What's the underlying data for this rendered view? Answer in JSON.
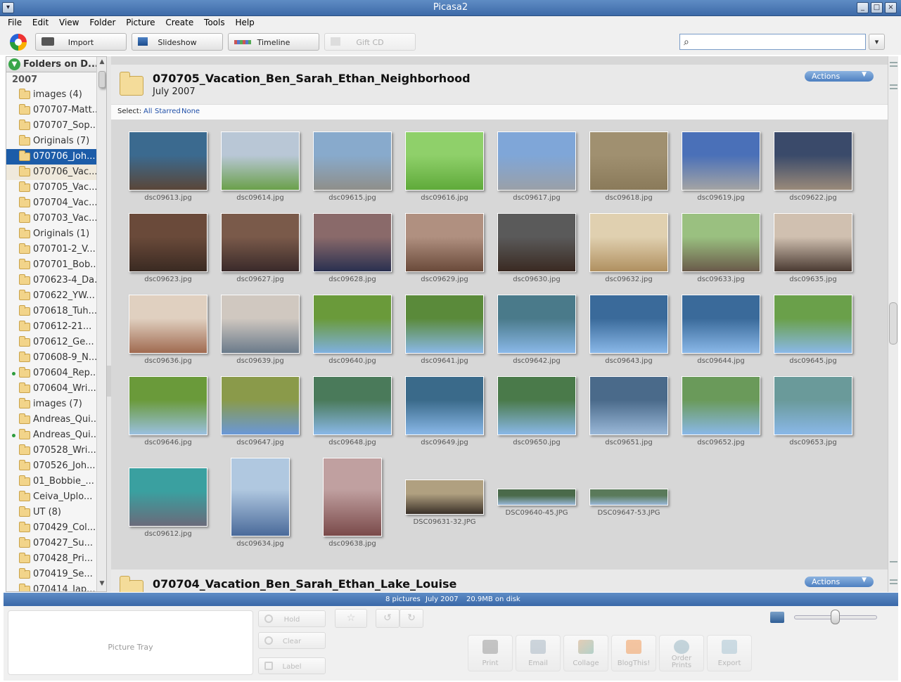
{
  "window": {
    "title": "Picasa2"
  },
  "menu": [
    "File",
    "Edit",
    "View",
    "Folder",
    "Picture",
    "Create",
    "Tools",
    "Help"
  ],
  "toolbar": {
    "import": "Import",
    "slideshow": "Slideshow",
    "timeline": "Timeline",
    "giftcd": "Gift CD"
  },
  "sidebar": {
    "header": "Folders on D...",
    "year": "2007",
    "folders": [
      {
        "label": "images (4)"
      },
      {
        "label": "070707-Matt..."
      },
      {
        "label": "070707_Sop..."
      },
      {
        "label": "Originals (7)"
      },
      {
        "label": "070706_Joh..."
      },
      {
        "label": "070706_Vac..."
      },
      {
        "label": "070705_Vac..."
      },
      {
        "label": "070704_Vac..."
      },
      {
        "label": "070703_Vac..."
      },
      {
        "label": "Originals (1)"
      },
      {
        "label": "070701-2_V..."
      },
      {
        "label": "070701_Bob..."
      },
      {
        "label": "070623-4_Da..."
      },
      {
        "label": "070622_YW..."
      },
      {
        "label": "070618_Tuh..."
      },
      {
        "label": "070612-21..."
      },
      {
        "label": "070612_Ge..."
      },
      {
        "label": "070608-9_N..."
      },
      {
        "label": "070604_Rep..."
      },
      {
        "label": "070604_Wri..."
      },
      {
        "label": "images (7)"
      },
      {
        "label": "Andreas_Qui..."
      },
      {
        "label": "Andreas_Qui..."
      },
      {
        "label": "070528_Wri..."
      },
      {
        "label": "070526_Joh..."
      },
      {
        "label": "01_Bobbie_..."
      },
      {
        "label": "Ceiva_Uplo..."
      },
      {
        "label": "UT (8)"
      },
      {
        "label": "070429_Col..."
      },
      {
        "label": "070427_Su..."
      },
      {
        "label": "070428_Pri..."
      },
      {
        "label": "070419_Se..."
      },
      {
        "label": "070414_Jap..."
      }
    ]
  },
  "album1": {
    "title": "070705_Vacation_Ben_Sarah_Ethan_Neighborhood",
    "date": "July 2007",
    "actions": "Actions"
  },
  "album2": {
    "title": "070704_Vacation_Ben_Sarah_Ethan_Lake_Louise",
    "actions": "Actions"
  },
  "select": {
    "label": "Select:",
    "all": "All",
    "starred": "Starred",
    "none": "None"
  },
  "photos": [
    "dsc09613.jpg",
    "dsc09614.jpg",
    "dsc09615.jpg",
    "dsc09616.jpg",
    "dsc09617.jpg",
    "dsc09618.jpg",
    "dsc09619.jpg",
    "dsc09622.jpg",
    "dsc09623.jpg",
    "dsc09627.jpg",
    "dsc09628.jpg",
    "dsc09629.jpg",
    "dsc09630.jpg",
    "dsc09632.jpg",
    "dsc09633.jpg",
    "dsc09635.jpg",
    "dsc09636.jpg",
    "dsc09639.jpg",
    "dsc09640.jpg",
    "dsc09641.jpg",
    "dsc09642.jpg",
    "dsc09643.jpg",
    "dsc09644.jpg",
    "dsc09645.jpg",
    "dsc09646.jpg",
    "dsc09647.jpg",
    "dsc09648.jpg",
    "dsc09649.jpg",
    "dsc09650.jpg",
    "dsc09651.jpg",
    "dsc09652.jpg",
    "dsc09653.jpg",
    "dsc09612.jpg",
    "dsc09634.jpg",
    "dsc09638.jpg",
    "DSC09631-32.JPG",
    "DSC09640-45.JPG",
    "DSC09647-53.JPG"
  ],
  "status": {
    "count": "8 pictures",
    "date": "July 2007",
    "size": "20.9MB on disk"
  },
  "tray": {
    "label": "Picture Tray",
    "hold": "Hold",
    "clear": "Clear",
    "labelbtn": "Label"
  },
  "actionsbar": {
    "print": "Print",
    "email": "Email",
    "collage": "Collage",
    "blogthis": "BlogThis!",
    "order1": "Order",
    "order2": "Prints",
    "export": "Export"
  }
}
